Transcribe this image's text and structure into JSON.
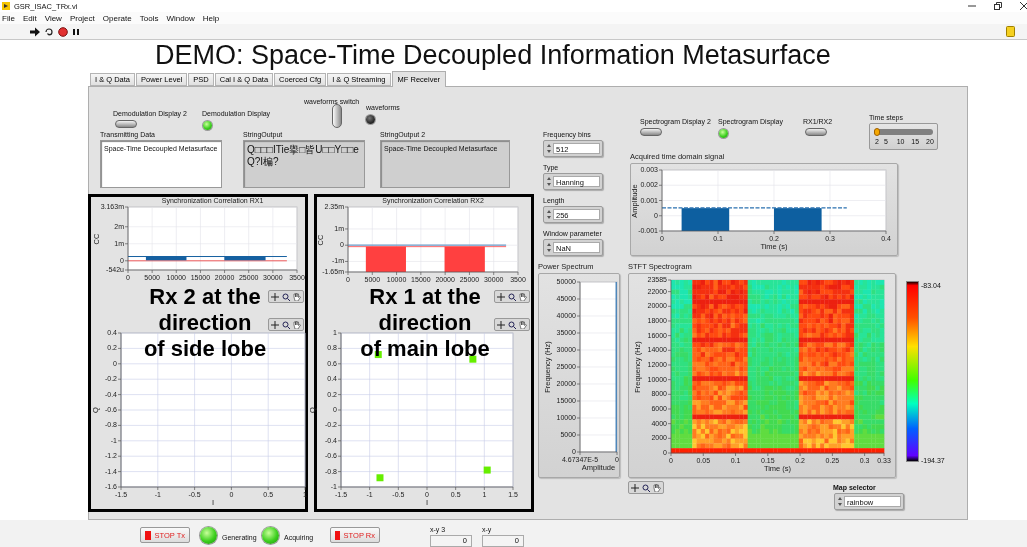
{
  "window": {
    "title": "GSR_ISAC_TRx.vi"
  },
  "menu": [
    "File",
    "Edit",
    "View",
    "Project",
    "Operate",
    "Tools",
    "Window",
    "Help"
  ],
  "heading": "DEMO: Space-Time Decoupled Information Metasurface",
  "tabs": [
    {
      "label": "I & Q Data",
      "selected": false
    },
    {
      "label": "Power Level",
      "selected": false
    },
    {
      "label": "PSD",
      "selected": false
    },
    {
      "label": "Cal I & Q Data",
      "selected": false
    },
    {
      "label": "Coerced Cfg",
      "selected": false
    },
    {
      "label": "I & Q Streaming",
      "selected": false
    },
    {
      "label": "MF Receiver",
      "selected": true
    }
  ],
  "switches": [
    {
      "kind": "toggle",
      "label": "Demodulation Display 2",
      "on": false
    },
    {
      "kind": "led",
      "label": "Demodulation Display",
      "on": true
    },
    {
      "kind": "vertical-toggle",
      "label": "waveforms switch",
      "on": false
    },
    {
      "kind": "led",
      "label": "waveforms",
      "on": false
    },
    {
      "kind": "toggle",
      "label": "Spectrogram Display 2",
      "on": false
    },
    {
      "kind": "led",
      "label": "Spectrogram Display",
      "on": true
    },
    {
      "kind": "toggle",
      "label": "RX1/RX2",
      "on": false
    }
  ],
  "text_boxes": [
    {
      "kind": "control",
      "label": "Transmitting Data",
      "value": "Space-Time Decoupled Metasurface"
    },
    {
      "kind": "indicator",
      "label": "StringOutput",
      "value": "Q□□□ITie擧□皆U□□Y□□eQ?I楄?"
    },
    {
      "kind": "indicator",
      "label": "StringOutput 2",
      "value": "Space-Time Decoupled Metasurface"
    }
  ],
  "numerics": [
    {
      "label": "Frequency bins",
      "value": "512"
    },
    {
      "label": "Type",
      "value": "Hanning"
    },
    {
      "label": "Length",
      "value": "256"
    },
    {
      "label": "Window parameter",
      "value": "NaN"
    }
  ],
  "time_steps": {
    "label": "Time steps",
    "level": 0,
    "ticks": [
      "2",
      "5",
      "10",
      "15",
      "20"
    ]
  },
  "plots": [
    {
      "kind": "pulse-strip",
      "title": "Synchronization Correlation RX1",
      "ylabel": "CC",
      "y_ticks": [
        "3.163m",
        "2m",
        "1m",
        "0",
        "-542u"
      ],
      "x_ticks": [
        "0",
        "5000",
        "10000",
        "15000",
        "20000",
        "25000",
        "30000",
        "3500"
      ],
      "color": "#1560a0"
    },
    {
      "kind": "pulse-dip",
      "title": "Synchronization Correlation RX2",
      "ylabel": "CC",
      "y_ticks": [
        "2.35m",
        "1m",
        "0",
        "-1m",
        "-1.65m"
      ],
      "x_ticks": [
        "0",
        "5000",
        "10000",
        "15000",
        "20000",
        "25000",
        "30000",
        "3500"
      ],
      "color": "#ff4040"
    },
    {
      "kind": "scatter",
      "chart_data": {
        "type": "scatter",
        "xlabel": "I",
        "ylabel": "Q",
        "grid": true,
        "xlim": [
          -1.5,
          1
        ],
        "ylim": [
          -1.6,
          0.4
        ],
        "xticks": [
          -1.5,
          -1,
          -0.5,
          0,
          0.5,
          1
        ],
        "yticks": [
          0.4,
          0.2,
          0,
          -0.2,
          -0.4,
          -0.6,
          -0.8,
          -1,
          -1.2,
          -1.4,
          -1.6
        ]
      }
    },
    {
      "kind": "scatter",
      "chart_data": {
        "type": "scatter",
        "xlabel": "I",
        "ylabel": "Q",
        "grid": true,
        "xlim": [
          -1.5,
          1.5
        ],
        "ylim": [
          -1,
          1
        ],
        "xticks": [
          -1.5,
          -1,
          -0.5,
          0,
          0.5,
          1,
          1.5
        ],
        "yticks": [
          1,
          0.8,
          0.6,
          0.4,
          0.2,
          0,
          -0.2,
          -0.4,
          -0.6,
          -0.8,
          -1
        ],
        "x": [
          -0.85,
          -0.82,
          0.8,
          1.05
        ],
        "series": [
          {
            "color": "#66ee00",
            "values": [
              0.72,
              -0.88,
              0.66,
              -0.78
            ]
          }
        ]
      }
    },
    {
      "kind": "time-signal",
      "label": "Acquired time domain signal",
      "xlabel": "Time (s)",
      "ylabel": "Amplitude",
      "y_ticks": [
        "0.003",
        "0.002",
        "0.001",
        "0",
        "-0.001"
      ],
      "x_ticks": [
        "0",
        "0.1",
        "0.2",
        "0.3",
        "0.4"
      ]
    },
    {
      "kind": "spectrum",
      "label": "Power Spectrum",
      "xlabel": "Amplitude",
      "ylabel": "Frequency (Hz)",
      "y_ticks": [
        "50000",
        "45000",
        "40000",
        "35000",
        "30000",
        "25000",
        "20000",
        "15000",
        "10000",
        "5000",
        "0"
      ],
      "x_ticks": [
        "4.67347E-5",
        "0"
      ]
    },
    {
      "kind": "spectrogram",
      "label": "STFT Spectrogram",
      "xlabel": "Time (s)",
      "ylabel": "Frequency (Hz)",
      "y_ticks": [
        "23585",
        "22000",
        "20000",
        "18000",
        "16000",
        "14000",
        "12000",
        "10000",
        "8000",
        "6000",
        "4000",
        "2000",
        "0"
      ],
      "x_ticks": [
        "0",
        "0.05",
        "0.1",
        "0.15",
        "0.2",
        "0.25",
        "0.3",
        "0.33"
      ]
    }
  ],
  "color_scale": {
    "max_label": "-83.04",
    "min_label": "-194.37"
  },
  "map_selector": {
    "label": "Map selector",
    "value": "rainbow"
  },
  "annotations": [
    "Rx 2 at the\ndirection\nof side lobe",
    "Rx 1 at the\ndirection\nof main lobe"
  ],
  "stop_buttons": [
    {
      "label": "STOP Tx"
    },
    {
      "label": "STOP Rx"
    }
  ],
  "status_leds": [
    {
      "label": "Generating",
      "on": true
    },
    {
      "label": "Acquiring",
      "on": true
    }
  ],
  "readouts": [
    {
      "label": "x-y 3",
      "value": "0"
    },
    {
      "label": "x-y",
      "value": "0"
    }
  ]
}
